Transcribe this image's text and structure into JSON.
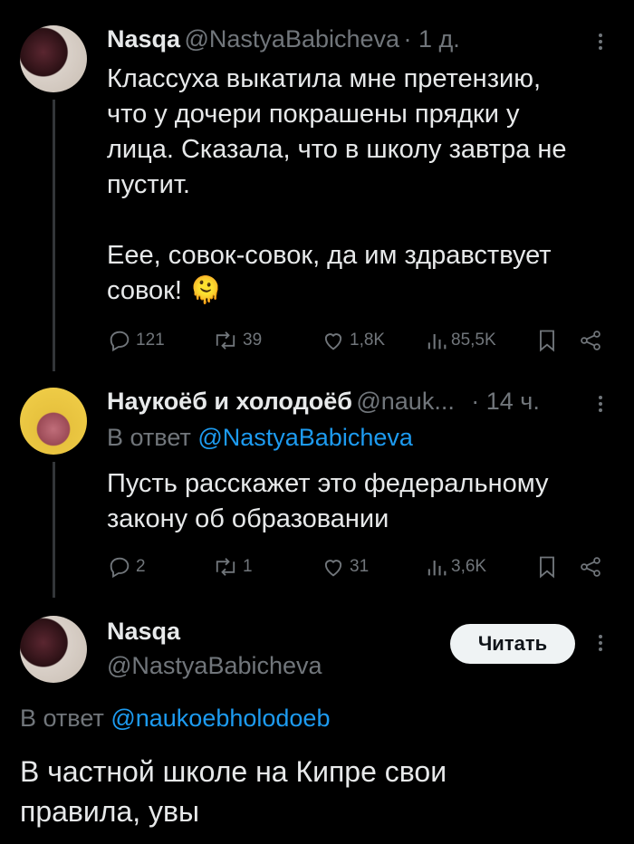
{
  "tweet1": {
    "name": "Nasqa",
    "handle": "@NastyaBabicheva",
    "time": "· 1 д.",
    "text_lines": [
      "Классуха выкатила мне претензию,",
      "что у дочери покрашены прядки у",
      "лица. Сказала, что в школу завтра не",
      "пустит."
    ],
    "text_lines2": [
      "Еее, совок-совок, да им здравствует",
      "совок! 🫠"
    ],
    "replies": "121",
    "reposts": "39",
    "likes": "1,8K",
    "views": "85,5K"
  },
  "tweet2": {
    "name": "Наукоёб и холодоёб",
    "handle": "@nauk...",
    "time": "· 14 ч.",
    "reply_prefix": "В ответ",
    "reply_to": "@NastyaBabicheva",
    "text_lines": [
      "Пусть расскажет это федеральному",
      "закону об образовании"
    ],
    "replies": "2",
    "reposts": "1",
    "likes": "31",
    "views": "3,6K"
  },
  "tweet3": {
    "name": "Nasqa",
    "handle": "@NastyaBabicheva",
    "follow_label": "Читать",
    "reply_prefix": "В ответ",
    "reply_to": "@naukoebholodoeb",
    "text_lines": [
      "В частной школе на Кипре свои",
      "правила, увы"
    ]
  },
  "colors": {
    "background": "#000000",
    "text": "#e7e9ea",
    "muted": "#71767b",
    "link": "#1d9bf0",
    "thread_line": "#333639"
  },
  "icons": [
    "reply-icon",
    "repost-icon",
    "like-icon",
    "views-icon",
    "bookmark-icon",
    "share-icon",
    "more-icon"
  ]
}
